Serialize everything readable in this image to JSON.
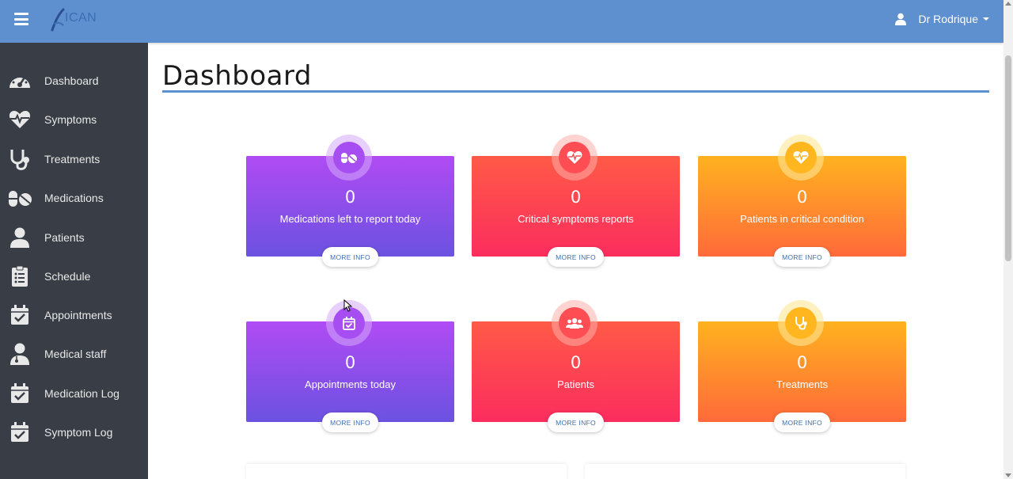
{
  "header": {
    "logo_text": "ICAN",
    "user_name": "Dr Rodrique"
  },
  "sidebar": {
    "items": [
      {
        "label": "Dashboard",
        "icon": "dashboard-gauge-icon"
      },
      {
        "label": "Symptoms",
        "icon": "heartbeat-icon"
      },
      {
        "label": "Treatments",
        "icon": "stethoscope-icon"
      },
      {
        "label": "Medications",
        "icon": "pills-icon"
      },
      {
        "label": "Patients",
        "icon": "user-icon"
      },
      {
        "label": "Schedule",
        "icon": "clipboard-list-icon"
      },
      {
        "label": "Appointments",
        "icon": "calendar-check-icon"
      },
      {
        "label": "Medical staff",
        "icon": "user-md-icon"
      },
      {
        "label": "Medication Log",
        "icon": "calendar-check-icon"
      },
      {
        "label": "Symptom Log",
        "icon": "calendar-check-icon"
      }
    ]
  },
  "main": {
    "title": "Dashboard",
    "cards": [
      {
        "count": "0",
        "label": "Medications left to report today",
        "button": "MORE INFO",
        "color": "purple",
        "icon": "pills-icon"
      },
      {
        "count": "0",
        "label": "Critical symptoms reports",
        "button": "MORE INFO",
        "color": "red",
        "icon": "heartbeat-icon"
      },
      {
        "count": "0",
        "label": "Patients in critical condition",
        "button": "MORE INFO",
        "color": "orange",
        "icon": "heartbeat-icon"
      },
      {
        "count": "0",
        "label": "Appointments today",
        "button": "MORE INFO",
        "color": "purple",
        "icon": "calendar-check-icon"
      },
      {
        "count": "0",
        "label": "Patients",
        "button": "MORE INFO",
        "color": "red",
        "icon": "users-icon"
      },
      {
        "count": "0",
        "label": "Treatments",
        "button": "MORE INFO",
        "color": "orange",
        "icon": "stethoscope-icon"
      }
    ]
  },
  "colors": {
    "header": "#5e8fcf",
    "sidebar": "#393d45",
    "purple": "#b04bf4",
    "red": "#ff5a47",
    "orange": "#ffb21f"
  }
}
